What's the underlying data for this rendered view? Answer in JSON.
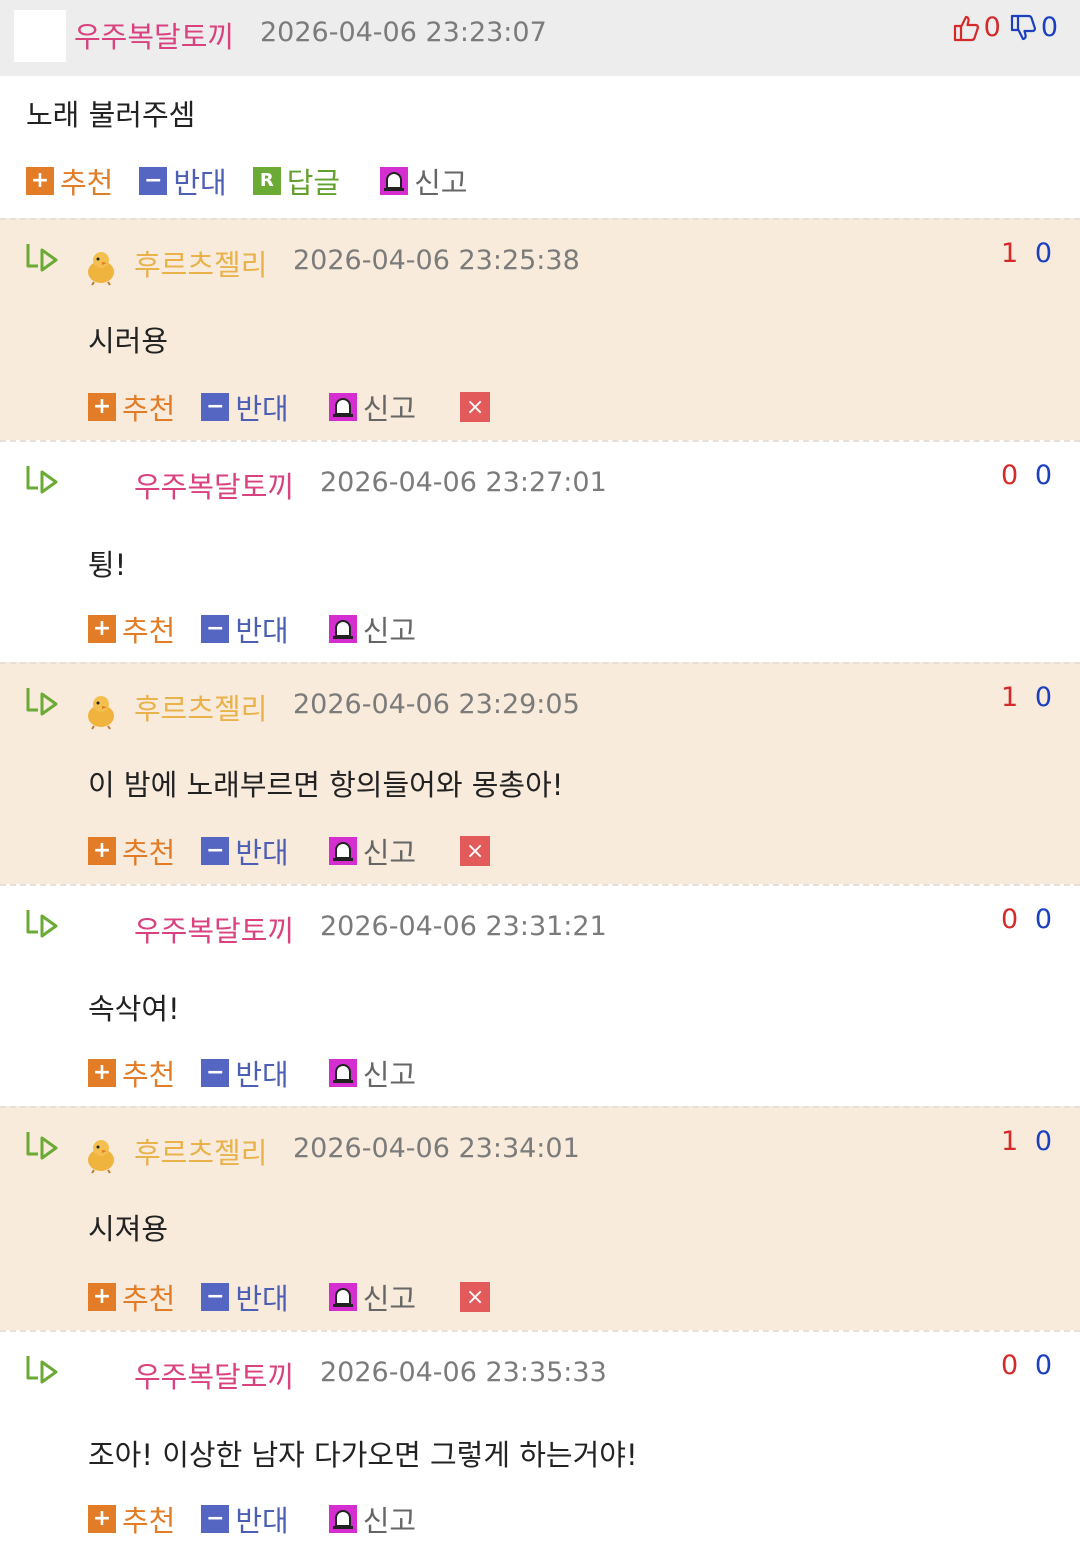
{
  "top_comment": {
    "nickname": "우주복달토끼",
    "date": "2026-04-06 23:23:07",
    "up": "0",
    "down": "0",
    "body": "노래 불러주셈"
  },
  "actions": {
    "recommend": "추천",
    "oppose": "반대",
    "reply": "답글",
    "report": "신고",
    "reply_icon": "R",
    "delete_icon": "×"
  },
  "replies": [
    {
      "nickname": "후르츠젤리",
      "date": "2026-04-06 23:25:38",
      "up": "1",
      "down": "0",
      "body": "시러용"
    },
    {
      "nickname": "우주복달토끼",
      "date": "2026-04-06 23:27:01",
      "up": "0",
      "down": "0",
      "body": "튕!"
    },
    {
      "nickname": "후르츠젤리",
      "date": "2026-04-06 23:29:05",
      "up": "1",
      "down": "0",
      "body": "이 밤에 노래부르면 항의들어와 몽총아!"
    },
    {
      "nickname": "우주복달토끼",
      "date": "2026-04-06 23:31:21",
      "up": "0",
      "down": "0",
      "body": "속삭여!"
    },
    {
      "nickname": "후르츠젤리",
      "date": "2026-04-06 23:34:01",
      "up": "1",
      "down": "0",
      "body": "시져용"
    },
    {
      "nickname": "우주복달토끼",
      "date": "2026-04-06 23:35:33",
      "up": "0",
      "down": "0",
      "body": "조아! 이상한 남자 다가오면 그렇게 하는거야!"
    }
  ],
  "colors": {
    "peach_bg": "#f8ebdc",
    "header_bg": "#ededed",
    "nick_pink": "#d9417f",
    "nick_yellow": "#e9b24a",
    "vote_red": "#d42a2a",
    "vote_blue": "#1b3fbf"
  }
}
